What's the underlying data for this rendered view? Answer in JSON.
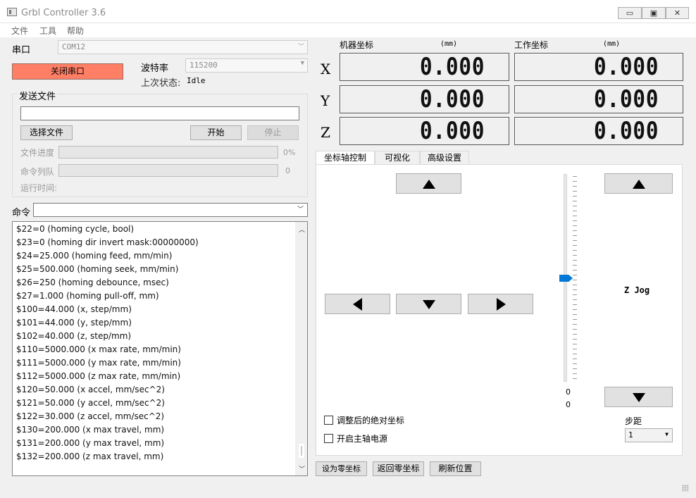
{
  "window": {
    "title": "Grbl Controller 3.6",
    "min": "▭",
    "max": "▣",
    "close": "✕"
  },
  "menu": [
    "文件",
    "工具",
    "帮助"
  ],
  "serial": {
    "label": "串口",
    "port": "COM12",
    "baud_label": "波特率",
    "baud": "115200",
    "close_port": "关闭串口",
    "last_state_label": "上次状态:",
    "last_state": "Idle"
  },
  "send_file": {
    "group_title": "发送文件",
    "choose": "选择文件",
    "start": "开始",
    "stop": "停止",
    "progress_label": "文件进度",
    "progress_pct": "0%",
    "progress_value": 0,
    "queue_label": "命令列队",
    "queue_count": "0",
    "runtime_label": "运行时间:"
  },
  "command": {
    "label": "命令"
  },
  "log": [
    "$22=0 (homing cycle, bool)",
    "$23=0 (homing dir invert mask:00000000)",
    "$24=25.000 (homing feed, mm/min)",
    "$25=500.000 (homing seek, mm/min)",
    "$26=250 (homing debounce, msec)",
    "$27=1.000 (homing pull-off, mm)",
    "$100=44.000 (x, step/mm)",
    "$101=44.000 (y, step/mm)",
    "$102=40.000 (z, step/mm)",
    "$110=5000.000 (x max rate, mm/min)",
    "$111=5000.000 (y max rate, mm/min)",
    "$112=5000.000 (z max rate, mm/min)",
    "$120=50.000 (x accel, mm/sec^2)",
    "$121=50.000 (y accel, mm/sec^2)",
    "$122=30.000 (z accel, mm/sec^2)",
    "$130=200.000 (x max travel, mm)",
    "$131=200.000 (y max travel, mm)",
    "$132=200.000 (z max travel, mm)"
  ],
  "coords": {
    "machine_label": "机器坐标",
    "work_label": "工作坐标",
    "unit": "(mm)",
    "axes": [
      "X",
      "Y",
      "Z"
    ],
    "machine": [
      "0.000",
      "0.000",
      "0.000"
    ],
    "work": [
      "0.000",
      "0.000",
      "0.000"
    ]
  },
  "tabs": [
    "坐标轴控制",
    "可视化",
    "高级设置"
  ],
  "jog": {
    "z_label": "Z Jog",
    "slider_value_1": "0",
    "slider_value_2": "0",
    "abs_coords": "调整后的绝对坐标",
    "spindle": "开启主轴电源",
    "step_label": "步距",
    "step_value": "1"
  },
  "bottom": {
    "zero": "设为零坐标",
    "goto_zero": "返回零坐标",
    "refresh": "刷新位置"
  }
}
